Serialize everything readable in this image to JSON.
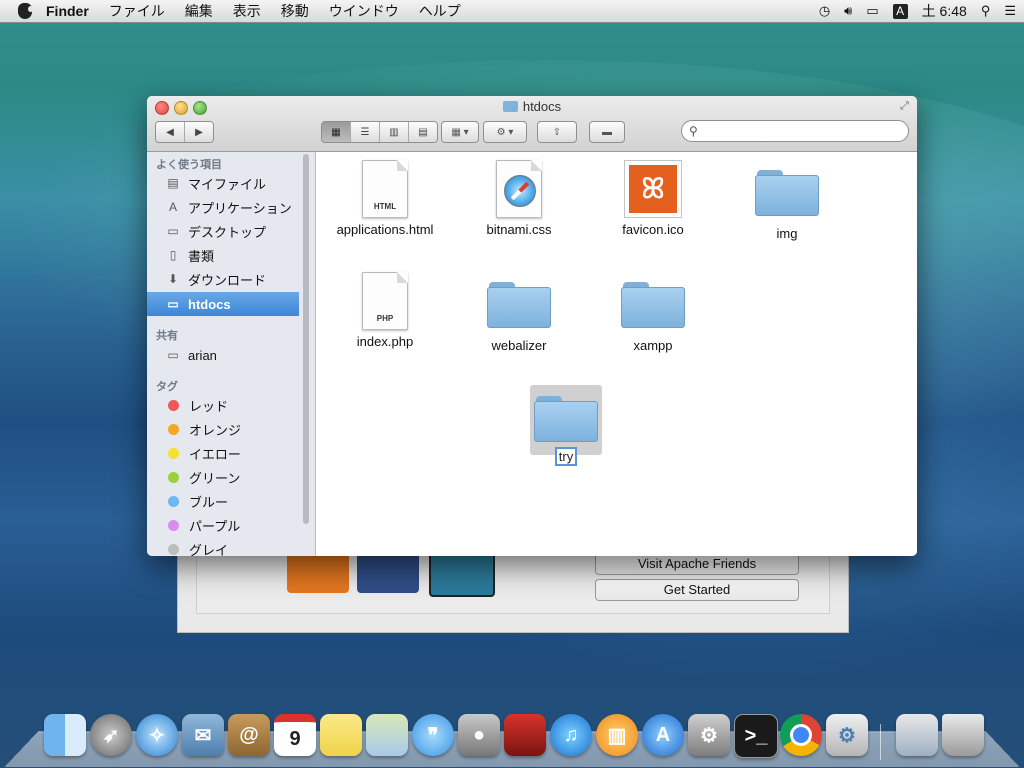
{
  "menubar": {
    "app_name": "Finder",
    "menus": [
      "ファイル",
      "編集",
      "表示",
      "移動",
      "ウインドウ",
      "ヘルプ"
    ],
    "input_mode": "A",
    "clock": "土 6:48"
  },
  "background_window": {
    "buttons": [
      "Visit Apache Friends",
      "Get Started"
    ],
    "tile_icons": [
      "xampp-logo-icon",
      "facebook-icon",
      "twitter-icon"
    ]
  },
  "finder": {
    "title": "htdocs",
    "search": {
      "placeholder": "",
      "value": ""
    },
    "sidebar": {
      "favorites_header": "よく使う項目",
      "favorites": [
        {
          "label": "マイファイル",
          "icon": "all-my-files-icon"
        },
        {
          "label": "アプリケーション",
          "icon": "applications-icon"
        },
        {
          "label": "デスクトップ",
          "icon": "desktop-icon"
        },
        {
          "label": "書類",
          "icon": "documents-icon"
        },
        {
          "label": "ダウンロード",
          "icon": "downloads-icon"
        },
        {
          "label": "htdocs",
          "icon": "folder-icon",
          "selected": true
        }
      ],
      "shared_header": "共有",
      "shared": [
        {
          "label": "arian",
          "icon": "computer-icon"
        }
      ],
      "tags_header": "タグ",
      "tags": [
        {
          "label": "レッド",
          "color": "#f0565a"
        },
        {
          "label": "オレンジ",
          "color": "#f5a623"
        },
        {
          "label": "イエロー",
          "color": "#f5e22a"
        },
        {
          "label": "グリーン",
          "color": "#9ad13b"
        },
        {
          "label": "ブルー",
          "color": "#6cb8f0"
        },
        {
          "label": "パープル",
          "color": "#d78cf0"
        },
        {
          "label": "グレイ",
          "color": "#bdbdbd"
        }
      ]
    },
    "files": [
      {
        "name": "applications.html",
        "kind": "document",
        "ext_label": "HTML"
      },
      {
        "name": "bitnami.css",
        "kind": "safari-document"
      },
      {
        "name": "favicon.ico",
        "kind": "xampp-icon"
      },
      {
        "name": "img",
        "kind": "folder"
      },
      {
        "name": "index.php",
        "kind": "document",
        "ext_label": "PHP"
      },
      {
        "name": "webalizer",
        "kind": "folder"
      },
      {
        "name": "xampp",
        "kind": "folder"
      },
      {
        "name": "try",
        "kind": "folder",
        "renaming": true
      }
    ]
  },
  "dock": {
    "apps": [
      "finder-icon",
      "launchpad-icon",
      "safari-icon",
      "mail-icon",
      "contacts-icon",
      "calendar-icon",
      "notes-icon",
      "maps-icon",
      "messages-icon",
      "facetime-icon",
      "photo-booth-icon",
      "itunes-icon",
      "ibooks-icon",
      "app-store-icon",
      "system-preferences-icon",
      "terminal-icon",
      "chrome-icon",
      "xampp-manager-icon"
    ],
    "calendar_day": "9",
    "right_items": [
      "desktop-stack-icon",
      "trash-icon"
    ]
  }
}
